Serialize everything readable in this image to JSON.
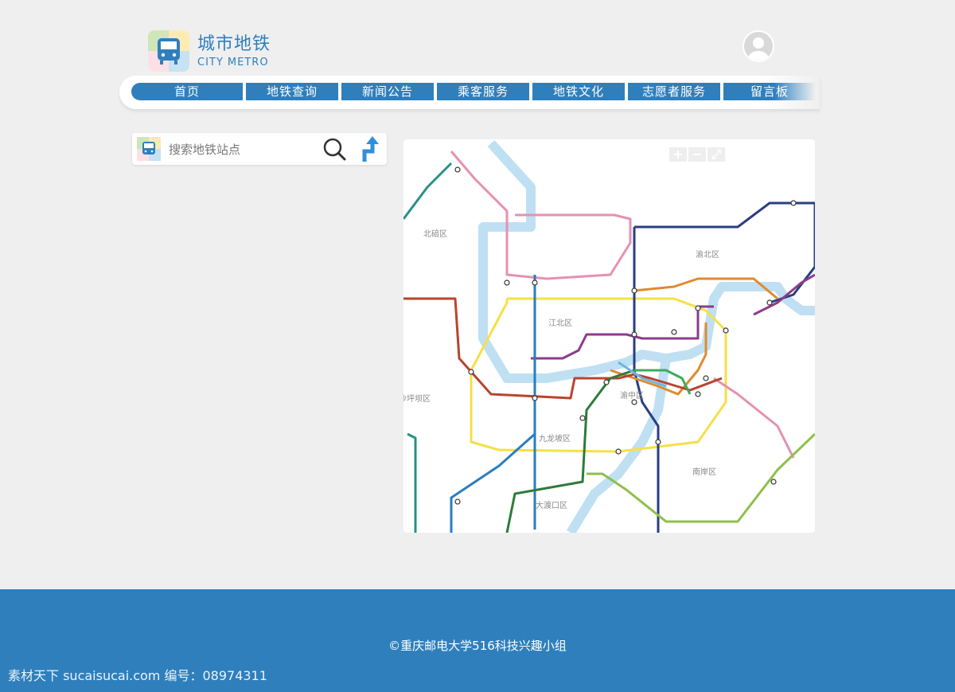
{
  "brand": {
    "title": "城市地铁",
    "subtitle": "CITY METRO"
  },
  "nav": {
    "items": [
      {
        "label": "首页"
      },
      {
        "label": "地铁查询"
      },
      {
        "label": "新闻公告"
      },
      {
        "label": "乘客服务"
      },
      {
        "label": "地铁文化"
      },
      {
        "label": "志愿者服务"
      },
      {
        "label": "留言板"
      }
    ]
  },
  "search": {
    "placeholder": "搜索地铁站点",
    "value": ""
  },
  "map": {
    "zoom_in": "+",
    "zoom_out": "−",
    "districts": [
      "北碚区",
      "江北区",
      "渝北区",
      "沙坪坝区",
      "渝中区",
      "九龙坡区",
      "南岸区",
      "大渡口区"
    ]
  },
  "footer": {
    "copyright": "©重庆邮电大学516科技兴趣小组"
  },
  "watermark": "素材天下 sucaisucai.com  编号：08974311",
  "colors": {
    "primary": "#2f7fbd",
    "background": "#efefef"
  }
}
